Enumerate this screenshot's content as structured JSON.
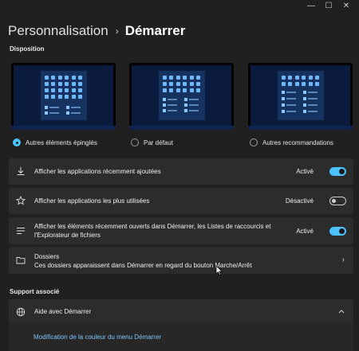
{
  "window": {
    "minimize": "—",
    "maximize": "☐",
    "close": "✕"
  },
  "breadcrumb": {
    "parent": "Personnalisation",
    "separator": "›",
    "current": "Démarrer"
  },
  "sections": {
    "layout": "Disposition",
    "support": "Support associé"
  },
  "layout_options": [
    {
      "label": "Autres éléments épinglés",
      "selected": true
    },
    {
      "label": "Par défaut",
      "selected": false
    },
    {
      "label": "Autres recommandations",
      "selected": false
    }
  ],
  "settings": {
    "recent_apps": {
      "label": "Afficher les applications récemment ajoutées",
      "state": "Activé",
      "on": true
    },
    "most_used": {
      "label": "Afficher les applications les plus utilisées",
      "state": "Désactivé",
      "on": false
    },
    "recent_items": {
      "label": "Afficher les éléments récemment ouverts dans Démarrer, les Listes de raccourcis et l'Explorateur de fichiers",
      "state": "Activé",
      "on": true
    },
    "folders": {
      "label": "Dossiers",
      "description": "Ces dossiers apparaissent dans Démarrer en regard du bouton Marche/Arrêt"
    }
  },
  "support": {
    "help": {
      "label": "Aide avec Démarrer"
    },
    "link": "Modification de la couleur du menu Démarrer"
  },
  "colors": {
    "accent": "#4cc2ff",
    "background": "#202020",
    "card": "#2c2c2c"
  }
}
